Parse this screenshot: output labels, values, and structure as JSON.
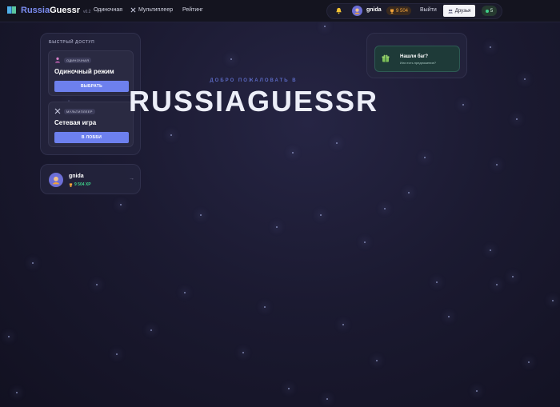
{
  "navbar": {
    "brand_part1": "Russia",
    "brand_part2": "Guessr",
    "version": "v0.2",
    "links": [
      "Одиночная",
      "Мультиплеер",
      "Рейтинг"
    ],
    "user_name": "gnida",
    "xp": "9 504",
    "logout": "Выйти",
    "friends": "Друзья",
    "online_count": "5"
  },
  "quick_access": {
    "title": "БЫСТРЫЙ ДОСТУП",
    "modes": [
      {
        "tag": "ОДИНОЧНАЯ",
        "name": "Одиночный режим",
        "button": "ВЫБРАТЬ",
        "icon": "person-icon"
      },
      {
        "tag": "МУЛЬТИПЛЕЕР",
        "name": "Сетевая игра",
        "button": "В ЛОББИ",
        "icon": "crossed-swords-icon"
      }
    ]
  },
  "profile": {
    "name": "gnida",
    "xp": "9 504 XP",
    "arrow": "→"
  },
  "bug_report": {
    "title": "Нашли баг?",
    "subtitle": "Или есть предложение?"
  },
  "hero": {
    "kicker": "ДОБРО ПОЖАЛОВАТЬ В",
    "title": "RUSSIAGUESSR"
  },
  "colors": {
    "accent": "#6d80ee",
    "xp_orange": "#f2a33a",
    "online_green": "#3ed08a",
    "background": "#1b1a31"
  }
}
